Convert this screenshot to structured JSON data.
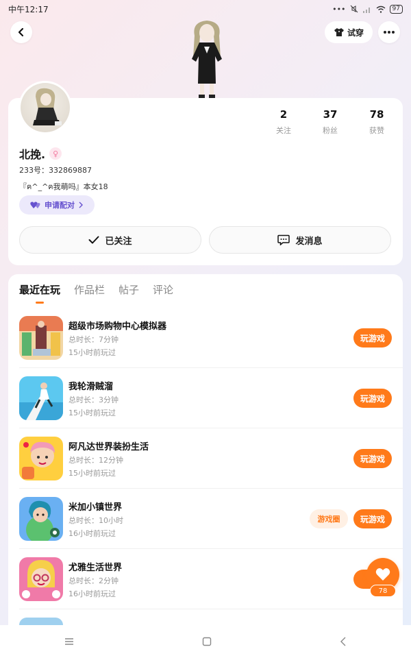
{
  "status_bar": {
    "time": "中午12:17",
    "dots": "•••",
    "battery": "97"
  },
  "header": {
    "try_on_label": "试穿"
  },
  "profile": {
    "name": "北挽.",
    "gender_symbol": "♀",
    "uid": "233号：332869887",
    "bio": "『ฅ^_^ฅ我萌吗』本女18",
    "match_label": "申请配对",
    "stats": [
      {
        "num": "2",
        "label": "关注"
      },
      {
        "num": "37",
        "label": "粉丝"
      },
      {
        "num": "78",
        "label": "获赞"
      }
    ],
    "followed_label": "已关注",
    "message_label": "发消息"
  },
  "tabs": [
    {
      "label": "最近在玩",
      "active": true
    },
    {
      "label": "作品栏",
      "active": false
    },
    {
      "label": "帖子",
      "active": false
    },
    {
      "label": "评论",
      "active": false
    }
  ],
  "games": [
    {
      "name": "超级市场购物中心模拟器",
      "duration": "总时长：7分钟",
      "last_played": "15小时前玩过",
      "play_label": "玩游戏"
    },
    {
      "name": "我轮滑贼溜",
      "duration": "总时长：3分钟",
      "last_played": "15小时前玩过",
      "play_label": "玩游戏"
    },
    {
      "name": "阿凡达世界装扮生活",
      "duration": "总时长：12分钟",
      "last_played": "15小时前玩过",
      "play_label": "玩游戏"
    },
    {
      "name": "米加小镇世界",
      "duration": "总时长：10小时",
      "last_played": "16小时前玩过",
      "play_label": "玩游戏",
      "circle_label": "游戏圈"
    },
    {
      "name": "尤雅生活世界",
      "duration": "总时长：2分钟",
      "last_played": "16小时前玩过",
      "play_label": "玩"
    }
  ],
  "fab": {
    "count": "78"
  },
  "colors": {
    "accent": "#ff7a1a",
    "match_purple": "#6652cf"
  }
}
